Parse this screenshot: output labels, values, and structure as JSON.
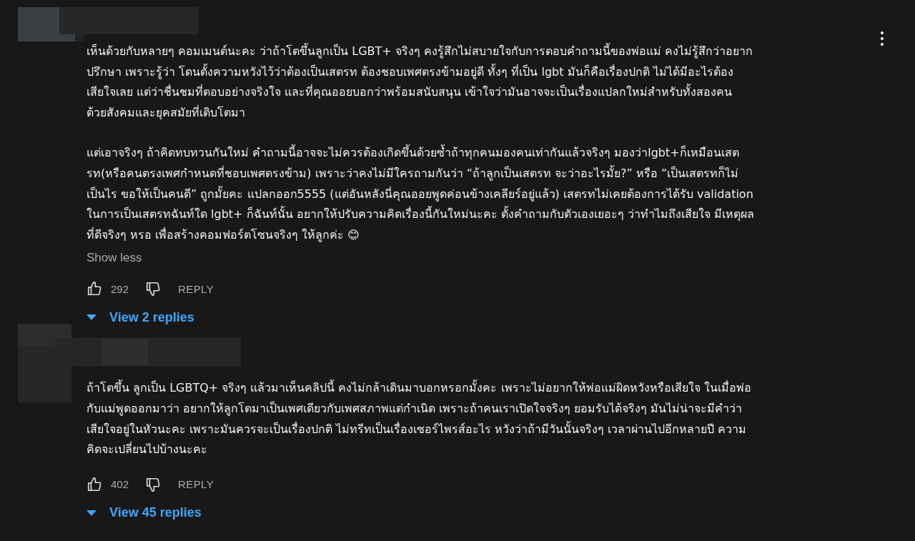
{
  "comments": [
    {
      "paragraphs": [
        [
          "เห็นด้วยกับหลายๆ คอมเมนต์นะคะ ว่าถ้าโตขึ้นลูกเป็น LGBT+ จริงๆ คงรู้สึกไม่สบายใจกับการตอบคำถามนี้ของพ่อแม่ คงไม่รู้สึกว่าอยาก",
          "ปรึกษา เพราะรู้ว่า โดนตั้งความหวังไว้ว่าต้องเป็นเสตรท ต้องชอบเพศตรงข้ามอยู่ดี ทั้งๆ ที่เป็น lgbt มันก็คือเรื่องปกติ ไม่ได้มีอะไรต้อง",
          "เสียใจเลย แต่ว่าชื่นชมที่ตอบอย่างจริงใจ และที่คุณออยบอกว่าพร้อมสนับสนุน เข้าใจว่ามันอาจจะเป็นเรื่องแปลกใหม่สำหรับทั้งสองคน",
          "ด้วยสังคมและยุคสมัยที่เติบโตมา"
        ],
        [
          "แต่เอาจริงๆ ถ้าคิดทบทวนกันใหม่ คำถามนี้อาจจะไม่ควรต้องเกิดขึ้นด้วยซ้ำถ้าทุกคนมองคนเท่ากันแล้วจริงๆ มองว่าlgbt+ก็เหมือนเสต",
          "รท(หรือคนตรงเพศกำหนดที่ชอบเพศตรงข้าม) เพราะว่าคงไม่มีใครถามกันว่า “ถ้าลูกเป็นเสตรท จะว่าอะไรมั้ย?” หรือ “เป็นเสตรทก็ไม่",
          "เป็นไร ขอให้เป็นคนดี” ถูกมั้ยคะ แปลกออก5555 (แต่อันหลังนี่คุณออยพูดค่อนข้างเคลียร์อยู่แล้ว) เสตรทไม่เคยต้องการได้รับ validation",
          "ในการเป็นเสตรทฉันท์ใด lgbt+ ก็ฉันท์นั้น อยากให้ปรับความคิดเรื่องนี้กันใหม่นะคะ ตั้งคำถามกับตัวเองเยอะๆ ว่าทำไมถึงเสียใจ มีเหตุผล",
          "ที่ดีจริงๆ หรอ เพื่อสร้างคอมฟอร์ตโซนจริงๆ ให้ลูกค่ะ 😊"
        ]
      ],
      "toggle": "Show less",
      "likes": "292",
      "reply": "REPLY",
      "replies": "View 2 replies"
    },
    {
      "paragraphs": [
        [
          "ถ้าโตขึ้น ลูกเป็น LGBTQ+ จริงๆ แล้วมาเห็นคลิปนี้  คงไม่กล้าเดินมาบอกหรอกมั้งคะ เพราะไม่อยากให้พ่อแม่ผิดหวังหรือเสียใจ ในเมื่อพ่อ",
          "กับแม่พูดออกมาว่า อยากให้ลูกโตมาเป็นเพศเดียวกับเพศสภาพแต่กำเนิด เพราะถ้าคนเราเปิดใจจริงๆ ยอมรับได้จริงๆ มันไม่น่าจะมีคำว่า",
          "เสียใจอยู่ในหัวนะคะ เพราะมันควรจะเป็นเรื่องปกติ ไม่ทรีทเป็นเรื่องเซอร์ไพรส์อะไร หวังว่าถ้ามีวันนั้นจริงๆ เวลาผ่านไปอีกหลายปี ความ",
          "คิดจะเปลี่ยนไปบ้างนะคะ"
        ]
      ],
      "likes": "402",
      "reply": "REPLY",
      "replies": "View 45 replies"
    }
  ]
}
